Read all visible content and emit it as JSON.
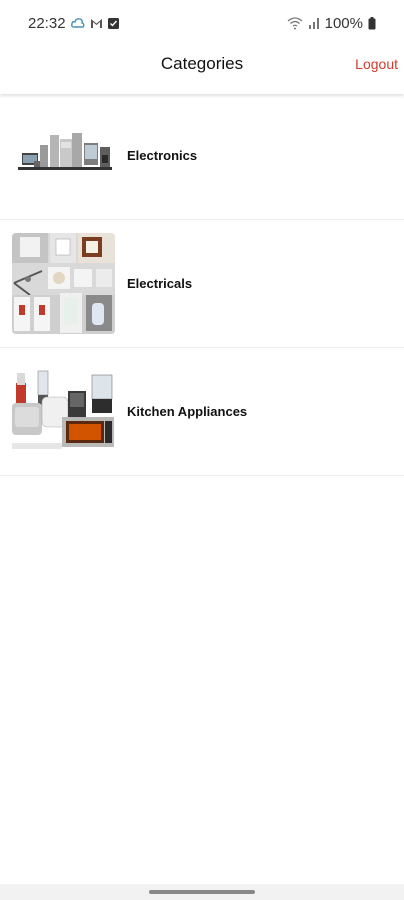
{
  "status_bar": {
    "time": "22:32",
    "battery": "100%",
    "left_icons": [
      "cloud-sync-icon",
      "gmail-icon",
      "notification-check-icon"
    ],
    "right_icons": [
      "wifi-icon",
      "signal-icon",
      "battery-icon"
    ]
  },
  "header": {
    "title": "Categories",
    "logout_label": "Logout",
    "logout_color": "#d43a2f"
  },
  "categories": [
    {
      "label": "Electronics",
      "image": "electronics-thumbnail"
    },
    {
      "label": "Electricals",
      "image": "electricals-thumbnail"
    },
    {
      "label": "Kitchen Appliances",
      "image": "kitchen-appliances-thumbnail"
    }
  ]
}
